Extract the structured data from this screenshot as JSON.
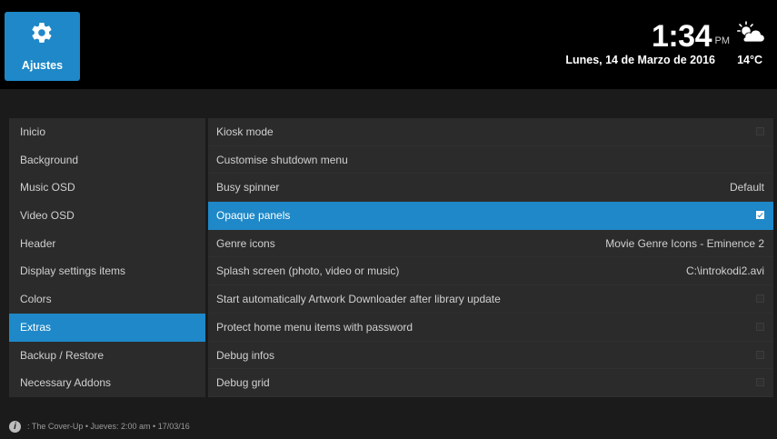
{
  "header": {
    "app_title": "Ajustes",
    "app_icon": "gear-icon",
    "time": "1:34",
    "ampm": "PM",
    "date": "Lunes, 14 de Marzo de 2016",
    "temperature": "14°C",
    "weather_icon": "partly-cloudy-icon"
  },
  "sidebar": {
    "items": [
      {
        "label": "Inicio",
        "active": false
      },
      {
        "label": "Background",
        "active": false
      },
      {
        "label": "Music OSD",
        "active": false
      },
      {
        "label": "Video OSD",
        "active": false
      },
      {
        "label": "Header",
        "active": false
      },
      {
        "label": "Display settings items",
        "active": false
      },
      {
        "label": "Colors",
        "active": false
      },
      {
        "label": "Extras",
        "active": true
      },
      {
        "label": "Backup / Restore",
        "active": false
      },
      {
        "label": "Necessary Addons",
        "active": false
      }
    ]
  },
  "settings": {
    "rows": [
      {
        "label": "Kiosk mode",
        "type": "checkbox",
        "checked": false,
        "value": ""
      },
      {
        "label": "Customise shutdown menu",
        "type": "action",
        "value": ""
      },
      {
        "label": "Busy spinner",
        "type": "value",
        "value": "Default"
      },
      {
        "label": "Opaque panels",
        "type": "checkbox",
        "checked": true,
        "value": ""
      },
      {
        "label": "Genre icons",
        "type": "value",
        "value": "Movie Genre Icons - Eminence 2"
      },
      {
        "label": "Splash screen (photo, video or music)",
        "type": "value",
        "value": "C:\\introkodi2.avi"
      },
      {
        "label": "Start automatically Artwork Downloader after library update",
        "type": "checkbox",
        "checked": false,
        "value": ""
      },
      {
        "label": "Protect home menu items with password",
        "type": "checkbox",
        "checked": false,
        "value": ""
      },
      {
        "label": "Debug infos",
        "type": "checkbox",
        "checked": false,
        "value": ""
      },
      {
        "label": "Debug grid",
        "type": "checkbox",
        "checked": false,
        "value": ""
      }
    ],
    "active_index": 3
  },
  "footer": {
    "info_icon": "info-icon",
    "text": ": The Cover-Up • Jueves: 2:00 am • 17/03/16"
  },
  "colors": {
    "accent": "#1e88c8",
    "panel": "#2b2b2b",
    "background": "#1b1b1b",
    "topbar": "#000000"
  }
}
